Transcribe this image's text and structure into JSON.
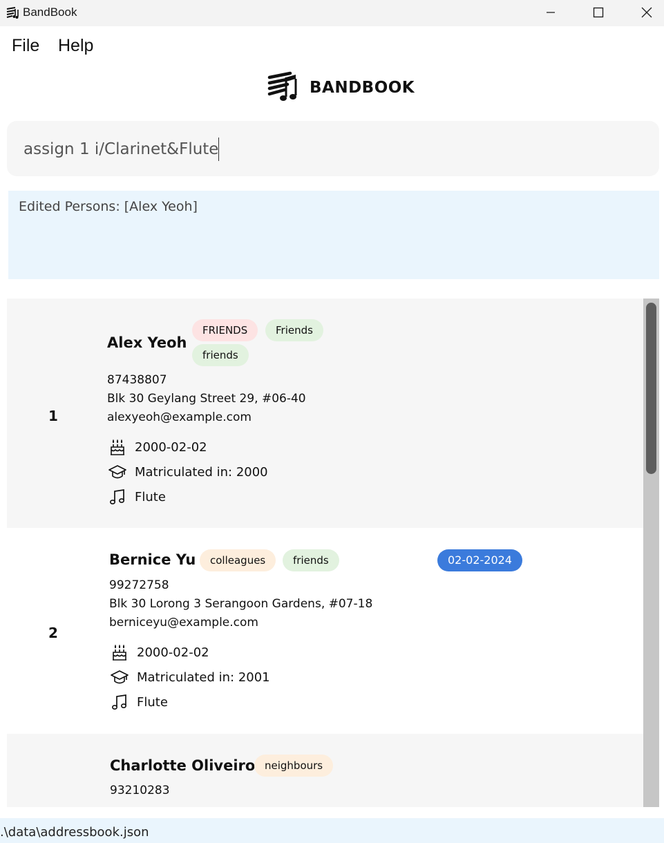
{
  "window": {
    "title": "BandBook",
    "minimize_glyph": "—",
    "maximize_glyph": "☐",
    "close_glyph": "✕"
  },
  "menu": {
    "file": "File",
    "help": "Help"
  },
  "logo": {
    "text": "BANDBOOK",
    "icon": "bandbook-music-logo-icon"
  },
  "command": {
    "value": "assign 1 i/Clarinet&Flute"
  },
  "result": {
    "text": "Edited Persons: [Alex Yeoh]"
  },
  "persons": [
    {
      "index": "1",
      "name": "Alex Yeoh",
      "tags": [
        {
          "label": "FRIENDS",
          "color": "#fde3e3"
        },
        {
          "label": "Friends",
          "color": "#e2f2df"
        },
        {
          "label": "friends",
          "color": "#e2f2df"
        }
      ],
      "phone": "87438807",
      "address": "Blk 30 Geylang Street 29, #06-40",
      "email": "alexyeoh@example.com",
      "birthday": "2000-02-02",
      "matriculation": "Matriculated in: 2000",
      "instrument": "Flute"
    },
    {
      "index": "2",
      "name": "Bernice Yu",
      "tags": [
        {
          "label": "colleagues",
          "color": "#fdeedd"
        },
        {
          "label": "friends",
          "color": "#e2f2df"
        }
      ],
      "date_badge": "02-02-2024",
      "phone": "99272758",
      "address": "Blk 30 Lorong 3 Serangoon Gardens, #07-18",
      "email": "berniceyu@example.com",
      "birthday": "2000-02-02",
      "matriculation": "Matriculated in: 2001",
      "instrument": "Flute"
    },
    {
      "name": "Charlotte Oliveiro",
      "tags": [
        {
          "label": "neighbours",
          "color": "#fdeedd"
        }
      ],
      "phone": "93210283"
    }
  ],
  "icons": {
    "birthday": "birthday-cake-icon",
    "matriculation": "graduation-cap-icon",
    "instrument": "music-note-icon"
  },
  "colors": {
    "accent_badge": "#3b7bdc",
    "result_bg": "#eaf5fd",
    "scroll_thumb": "#5e5e5e"
  },
  "status": {
    "path": ".\\data\\addressbook.json"
  }
}
